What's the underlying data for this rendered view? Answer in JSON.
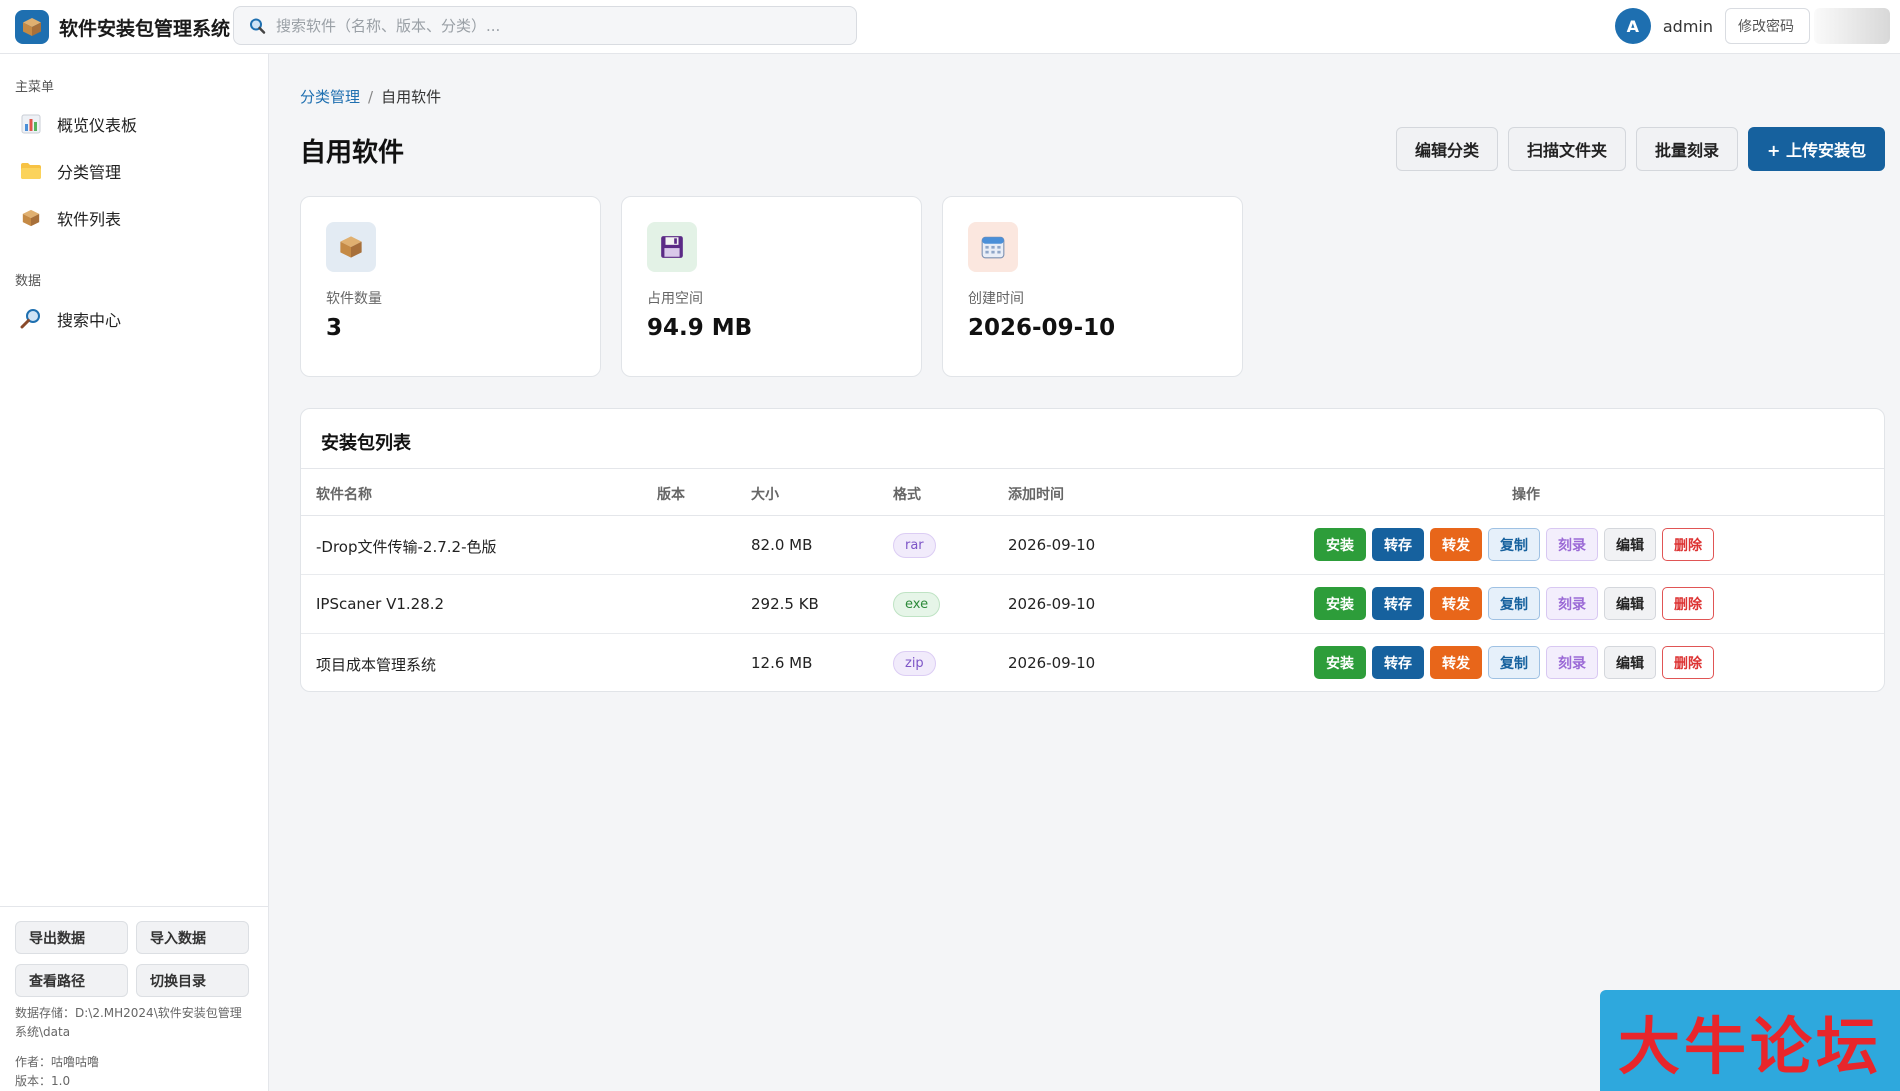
{
  "header": {
    "app_title": "软件安装包管理系统",
    "search_placeholder": "搜索软件（名称、版本、分类）...",
    "avatar_letter": "A",
    "username": "admin",
    "change_password": "修改密码"
  },
  "sidebar": {
    "main_menu_label": "主菜单",
    "main_items": [
      {
        "label": "概览仪表板",
        "icon": "bar-chart-icon"
      },
      {
        "label": "分类管理",
        "icon": "folder-icon"
      },
      {
        "label": "软件列表",
        "icon": "package-icon"
      }
    ],
    "data_label": "数据",
    "data_items": [
      {
        "label": "搜索中心",
        "icon": "magnifier-icon"
      }
    ],
    "buttons": {
      "export": "导出数据",
      "import": "导入数据",
      "view_path": "查看路径",
      "switch_dir": "切换目录"
    },
    "storage_text": "数据存储：D:\\2.MH2024\\软件安装包管理系统\\data",
    "author_text": "作者：咕噜咕噜",
    "version_text": "版本：1.0"
  },
  "breadcrumb": {
    "parent": "分类管理",
    "separator": "/",
    "current": "自用软件"
  },
  "page": {
    "title": "自用软件",
    "actions": {
      "edit_category": "编辑分类",
      "scan_folder": "扫描文件夹",
      "batch_burn": "批量刻录",
      "upload": "+ 上传安装包"
    }
  },
  "stats": [
    {
      "label": "软件数量",
      "value": "3",
      "icon": "package-icon"
    },
    {
      "label": "占用空间",
      "value": "94.9 MB",
      "icon": "floppy-disk-icon"
    },
    {
      "label": "创建时间",
      "value": "2026-09-10",
      "icon": "calendar-icon"
    }
  ],
  "table": {
    "title": "安装包列表",
    "columns": {
      "name": "软件名称",
      "version": "版本",
      "size": "大小",
      "format": "格式",
      "added": "添加时间",
      "actions": "操作"
    },
    "rows": [
      {
        "name": "-Drop文件传输-2.7.2-色版",
        "version": "",
        "size": "82.0 MB",
        "format": "rar",
        "added": "2026-09-10"
      },
      {
        "name": "IPScaner V1.28.2",
        "version": "",
        "size": "292.5 KB",
        "format": "exe",
        "added": "2026-09-10"
      },
      {
        "name": "项目成本管理系统",
        "version": "",
        "size": "12.6 MB",
        "format": "zip",
        "added": "2026-09-10"
      }
    ],
    "row_actions": {
      "install": "安装",
      "save": "转存",
      "forward": "转发",
      "copy": "复制",
      "burn": "刻录",
      "edit": "编辑",
      "delete": "删除"
    }
  },
  "watermark": "大牛论坛",
  "colors": {
    "primary": "#16619e",
    "install": "#2d9d3a",
    "forward": "#e8661a",
    "delete": "#dd3333",
    "rar_badge": "#f1ebfb",
    "exe_badge": "#e6f5e8",
    "zip_badge": "#f1ebfb"
  }
}
